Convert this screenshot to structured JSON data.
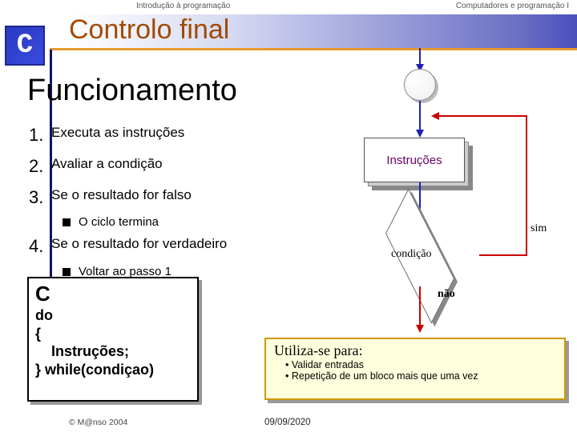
{
  "header": {
    "left": "Introdução à programação",
    "right": "Computadores e programação I"
  },
  "title": "Controlo final",
  "logo": "C",
  "section": "Funcionamento",
  "steps": {
    "s1": {
      "n": "1.",
      "t": "Executa as instruções"
    },
    "s2": {
      "n": "2.",
      "t": "Avaliar a condição"
    },
    "s3": {
      "n": "3.",
      "t": "Se o resultado for falso"
    },
    "s3a": "O ciclo termina",
    "s4": {
      "n": "4.",
      "t": "Se o resultado for verdadeiro"
    },
    "s4a": "Voltar ao passo 1"
  },
  "code": {
    "lang": "C",
    "l1": "do",
    "l2": "{",
    "l3": "Instruções;",
    "l4": "} while(condiçao)"
  },
  "flowchart": {
    "proc": "Instruções",
    "cond": "condição",
    "yes": "sim",
    "no": "não"
  },
  "use": {
    "head": "Utiliza-se para:",
    "b1": "• Validar entradas",
    "b2": "• Repetição de um bloco mais que uma vez"
  },
  "footer": {
    "copy": "© M@nso 2004",
    "date": "09/09/2020"
  }
}
